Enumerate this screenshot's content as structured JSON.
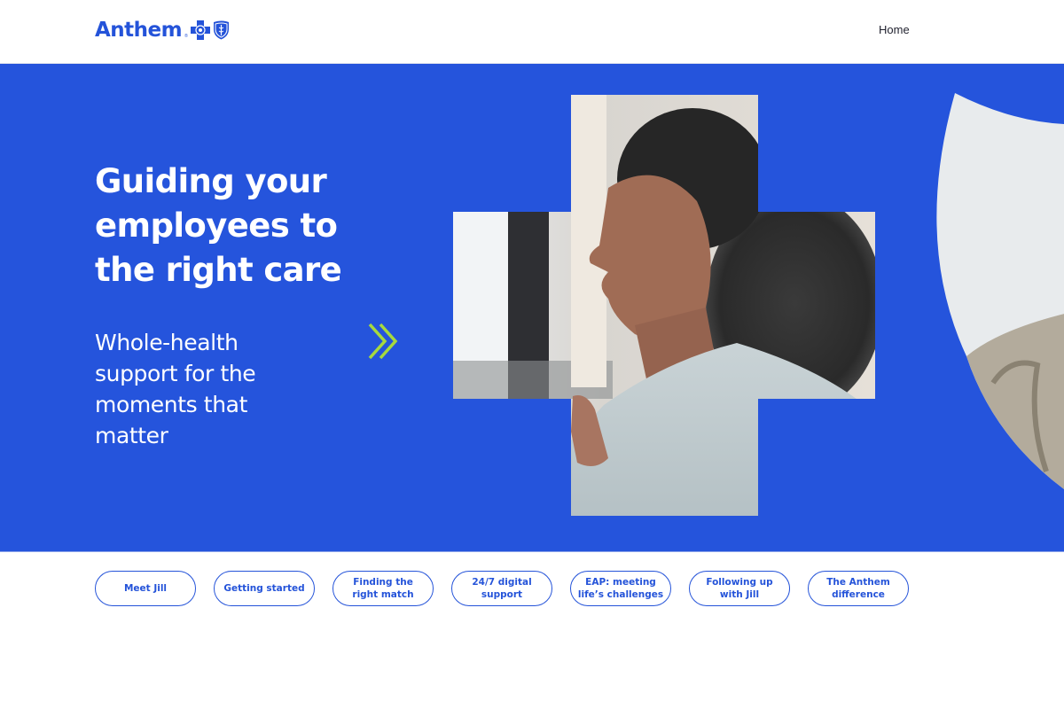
{
  "brand": {
    "name": "Anthem",
    "trademark": "®",
    "primary_color": "#2554dc",
    "accent_color": "#a6d93f"
  },
  "header": {
    "nav": [
      {
        "label": "Home"
      }
    ]
  },
  "hero": {
    "title": "Guiding your employees to the right care",
    "subtitle": "Whole-health support for the moments that matter",
    "next_icon": "double-chevron-right-icon",
    "photo_description": "Smiling woman with curly hair in profile, framed in a cross shape"
  },
  "chips": [
    {
      "label": "Meet Jill"
    },
    {
      "label": "Getting started"
    },
    {
      "label": "Finding the right match"
    },
    {
      "label": "24/7 digital support"
    },
    {
      "label": "EAP: meeting life’s challenges"
    },
    {
      "label": "Following up with Jill"
    },
    {
      "label": "The Anthem difference"
    }
  ]
}
